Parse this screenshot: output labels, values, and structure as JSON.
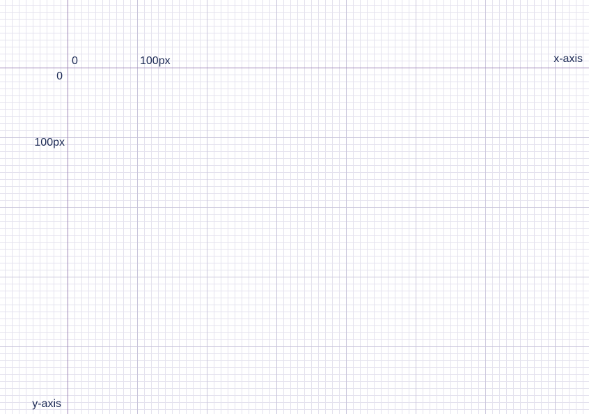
{
  "colors": {
    "label_text": "#1c2a55",
    "axis_line": "#9d83b6",
    "major_grid": "#c9c5db",
    "minor_grid": "#e4e2ee"
  },
  "labels": {
    "x_zero": "0",
    "x_100": "100px",
    "x_axis": "x-axis",
    "y_zero": "0",
    "y_100": "100px",
    "y_axis": "y-axis"
  }
}
